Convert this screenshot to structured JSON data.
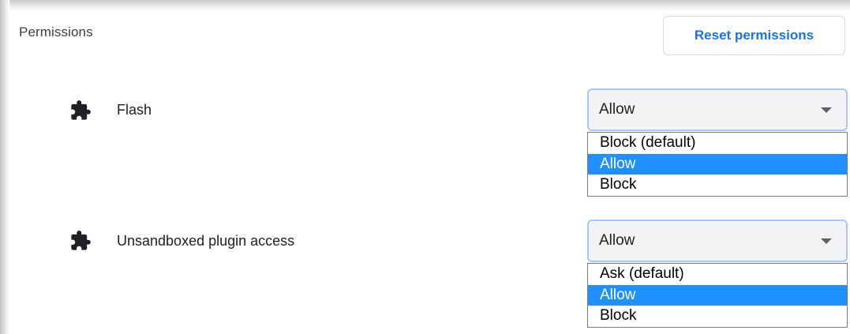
{
  "section": {
    "title": "Permissions",
    "reset_label": "Reset permissions"
  },
  "permissions": [
    {
      "label": "Flash",
      "icon": "puzzle-piece-icon",
      "selected_value": "Allow",
      "options": [
        "Block (default)",
        "Allow",
        "Block"
      ],
      "highlighted_option_index": 1
    },
    {
      "label": "Unsandboxed plugin access",
      "icon": "puzzle-piece-icon",
      "selected_value": "Allow",
      "options": [
        "Ask (default)",
        "Allow",
        "Block"
      ],
      "highlighted_option_index": 1
    }
  ],
  "colors": {
    "accent": "#1a73e8",
    "option_highlight": "#1e90ff",
    "select_border": "#a8c7fa",
    "select_background": "#f1f3f4"
  }
}
